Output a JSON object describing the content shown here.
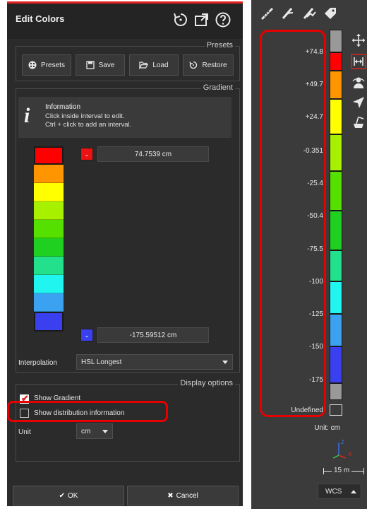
{
  "edit_colors": {
    "title": "Edit Colors",
    "presets_group": {
      "title": "Presets",
      "buttons": {
        "presets": "Presets",
        "save": "Save",
        "load": "Load",
        "restore": "Restore"
      }
    },
    "gradient_group": {
      "title": "Gradient",
      "info": {
        "title": "Information",
        "line1": "Click inside interval to edit.",
        "line2": "Ctrl + click to add an interval."
      },
      "top_value": "74.7539 cm",
      "bottom_value": "-175.59512 cm",
      "interpolation_label": "Interpolation",
      "interpolation_value": "HSL Longest"
    },
    "display_options": {
      "title": "Display options",
      "show_gradient": "Show Gradient",
      "show_gradient_checked": true,
      "show_distribution": "Show distribution information",
      "show_distribution_checked": false,
      "unit_label": "Unit",
      "unit_value": "cm"
    },
    "footer": {
      "ok": "OK",
      "cancel": "Cancel"
    },
    "colors": {
      "gradient": [
        "#ff0000",
        "#ff9500",
        "#ffff00",
        "#a6f000",
        "#55e000",
        "#20d020",
        "#23e08c",
        "#20f5f0",
        "#3aa2f0",
        "#3a40f0"
      ],
      "accent": "#e22222"
    }
  },
  "scale_panel": {
    "labels": [
      "+74.8",
      "+49.7",
      "+24.7",
      "-0.351",
      "-25.4",
      "-50.4",
      "-75.5",
      "-100",
      "-125",
      "-150",
      "-175"
    ],
    "undefined_label": "Undefined",
    "unit_text": "Unit: cm",
    "scale_text": "15 m",
    "wcs_label": "WCS",
    "bar_colors": [
      "#ff0000",
      "#ff9500",
      "#ffff00",
      "#a6f000",
      "#55e000",
      "#20d020",
      "#23e08c",
      "#20f5f0",
      "#3aa2f0",
      "#3a40f0"
    ],
    "toolbar_icons": [
      "measure-icon",
      "cut-icon",
      "cut-plane-icon",
      "tag-icon"
    ],
    "side_icons": [
      "move-icon",
      "fit-width-icon",
      "person-view-icon",
      "navigate-icon",
      "clean-icon"
    ]
  }
}
